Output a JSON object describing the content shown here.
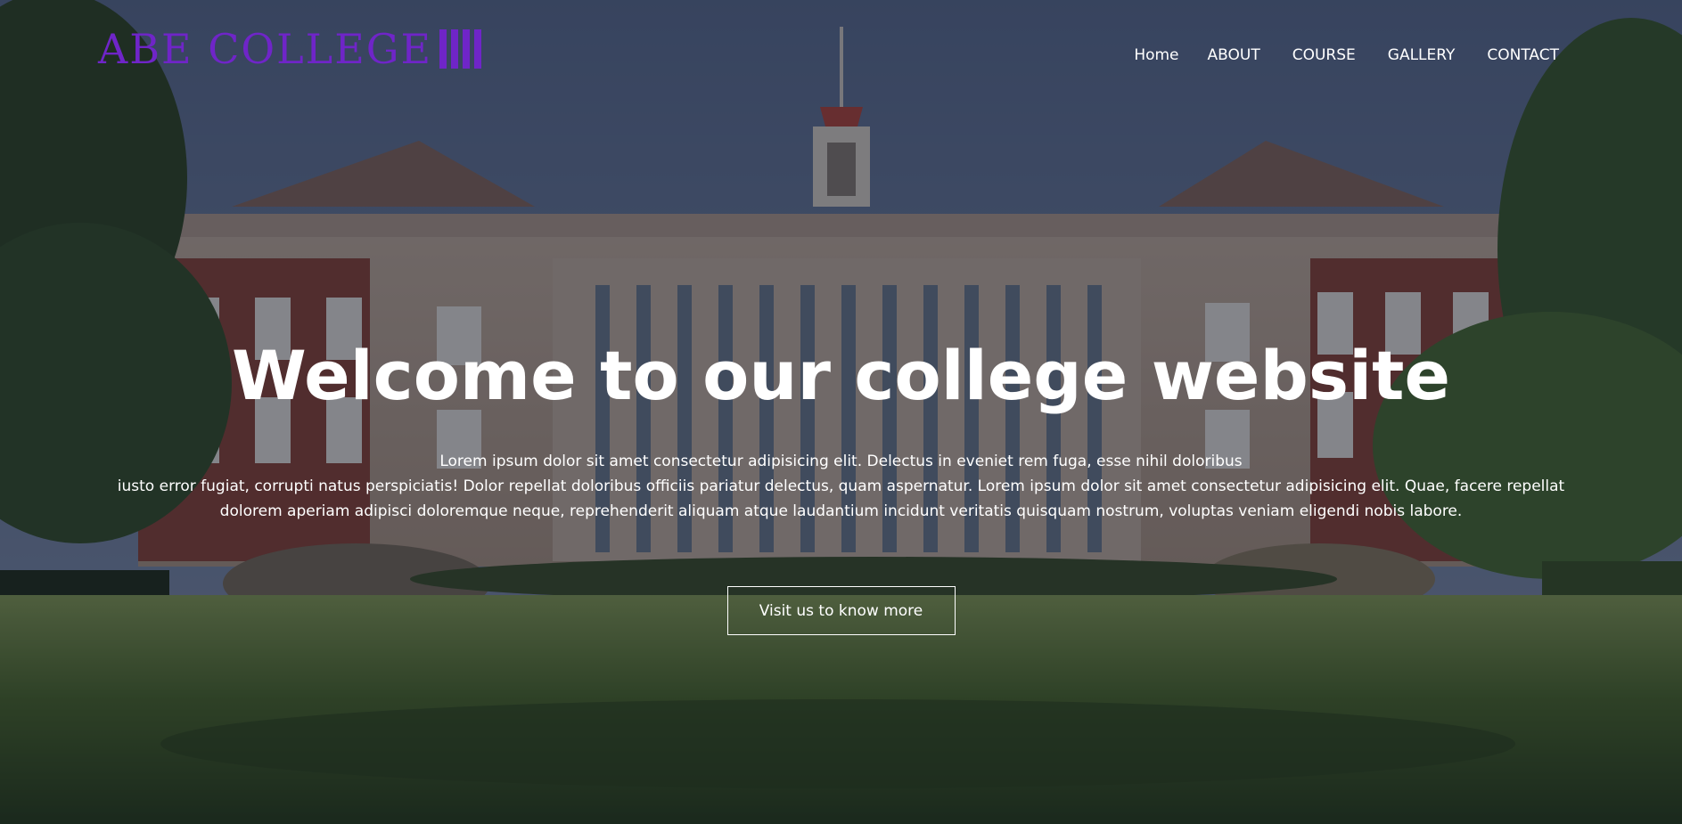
{
  "logo": {
    "text": "ABE COLLEGE",
    "color": "#6f25c8"
  },
  "nav": {
    "items": [
      {
        "label": "Home"
      },
      {
        "label": "ABOUT"
      },
      {
        "label": "COURSE"
      },
      {
        "label": "GALLERY"
      },
      {
        "label": "CONTACT"
      }
    ]
  },
  "hero": {
    "title": "Welcome to our college website",
    "description_line1": "Lorem ipsum dolor sit amet consectetur adipisicing elit. Delectus in eveniet rem fuga, esse nihil doloribus",
    "description_line2": "iusto error fugiat, corrupti natus perspiciatis! Dolor repellat doloribus officiis pariatur delectus, quam aspernatur. Lorem ipsum dolor sit amet consectetur adipisicing elit. Quae, facere repellat",
    "description_line3": "dolorem aperiam adipisci doloremque neque, reprehenderit aliquam atque laudantium incidunt veritatis quisquam nostrum, voluptas veniam eligendi nobis labore.",
    "cta_label": "Visit us to know more"
  },
  "colors": {
    "accent": "#6f25c8",
    "text": "#ffffff"
  }
}
